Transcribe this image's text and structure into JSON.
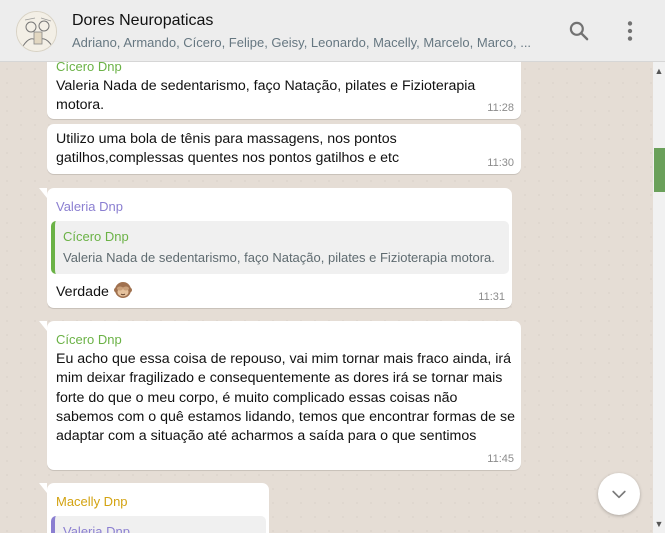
{
  "header": {
    "title": "Dores Neuropaticas",
    "participants": "Adriano, Armando, Cícero, Felipe, Geisy, Leonardo, Macelly, Marcelo, Marco, ..."
  },
  "colors": {
    "sender_cicero": "#6bb246",
    "sender_valeria": "#8b7fd1",
    "sender_macelly": "#d3a312",
    "bubble": "#ffffff",
    "chat_bg": "#e5ddd5"
  },
  "icons": {
    "search": "search-icon",
    "menu": "kebab-menu-icon",
    "scroll_down": "chevron-down-icon",
    "emoji": "see-no-evil-monkey"
  },
  "messages": [
    {
      "sender": "Cícero Dnp",
      "text": "Valeria Nada de sedentarismo, faço Natação, pilates e Fizioterapia motora.",
      "time": "11:28"
    },
    {
      "text": "Utilizo uma bola de tênis para massagens, nos pontos gatilhos,complessas quentes nos pontos gatilhos e etc",
      "time": "11:30"
    },
    {
      "sender": "Valeria Dnp",
      "quote": {
        "sender": "Cícero Dnp",
        "text": "Valeria Nada de sedentarismo, faço Natação, pilates e Fizioterapia motora."
      },
      "text": "Verdade",
      "time": "11:31"
    },
    {
      "sender": "Cícero Dnp",
      "text": "Eu acho que essa coisa de repouso, vai mim tornar mais fraco ainda, irá mim deixar fragilizado e consequentemente as dores irá se tornar mais forte do que o meu corpo, é muito complicado essas coisas não sabemos com o quê estamos lidando, temos que encontrar formas de se adaptar com a situação até acharmos a saída para o que sentimos",
      "time": "11:45"
    },
    {
      "sender": "Macelly Dnp",
      "quote": {
        "sender": "Valeria Dnp"
      }
    }
  ]
}
